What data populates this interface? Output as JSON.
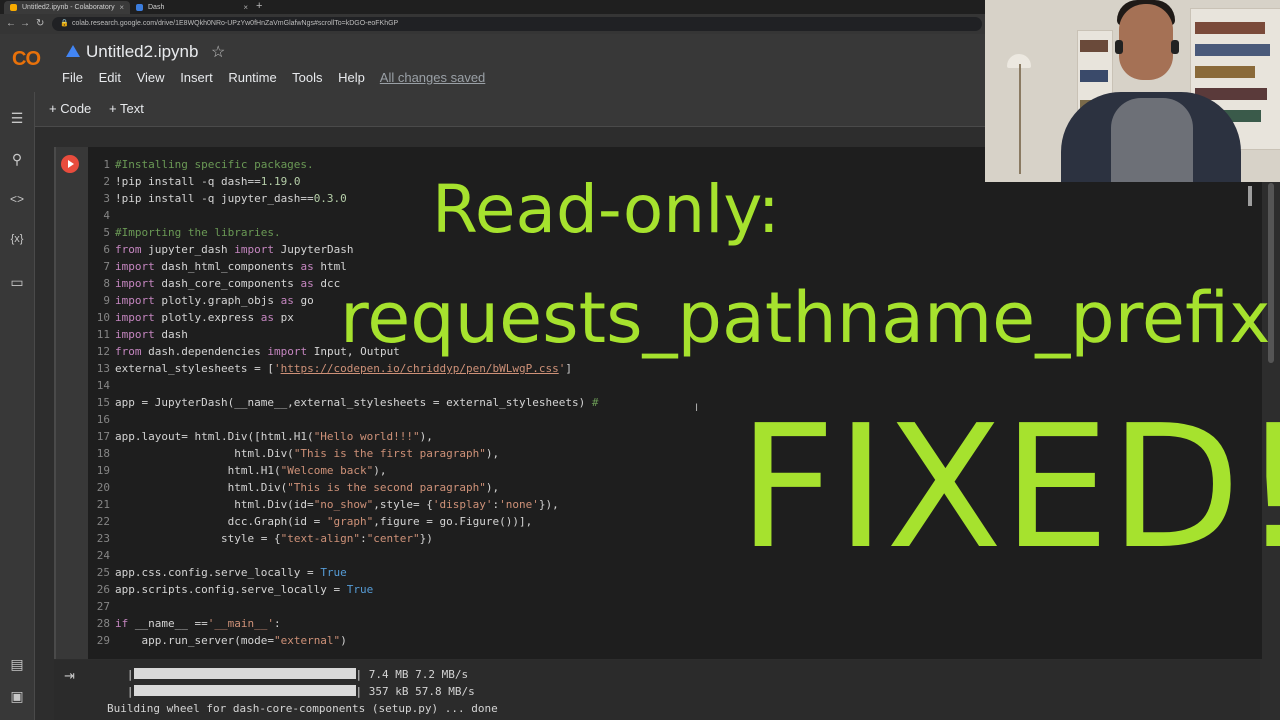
{
  "browser": {
    "tabs": [
      {
        "title": "Untitled2.ipynb - Colaboratory"
      },
      {
        "title": "Dash"
      }
    ],
    "url": "colab.research.google.com/drive/1E8WQkh0NRo-UPzYw0fHnZaVmGlafwNgs#scrollTo=kDGO-eoFKhGP"
  },
  "colab": {
    "logo": "CO",
    "title": "Untitled2.ipynb",
    "menu": [
      "File",
      "Edit",
      "View",
      "Insert",
      "Runtime",
      "Tools",
      "Help"
    ],
    "saved_status": "All changes saved",
    "toolbar": {
      "add_code": "+ Code",
      "add_text": "+ Text"
    }
  },
  "code_lines": [
    {
      "n": "1",
      "parts": [
        [
          "c-com",
          "#Installing specific packages."
        ]
      ]
    },
    {
      "n": "2",
      "parts": [
        [
          "c-plain",
          "!pip install -q dash=="
        ],
        [
          "c-num",
          "1.19.0"
        ]
      ]
    },
    {
      "n": "3",
      "parts": [
        [
          "c-plain",
          "!pip install -q jupyter_dash=="
        ],
        [
          "c-num",
          "0.3.0"
        ]
      ]
    },
    {
      "n": "4",
      "parts": []
    },
    {
      "n": "5",
      "parts": [
        [
          "c-com",
          "#Importing the libraries."
        ]
      ]
    },
    {
      "n": "6",
      "parts": [
        [
          "c-kw",
          "from"
        ],
        [
          "c-plain",
          " jupyter_dash "
        ],
        [
          "c-kw",
          "import"
        ],
        [
          "c-plain",
          " JupyterDash"
        ]
      ]
    },
    {
      "n": "7",
      "parts": [
        [
          "c-kw",
          "import"
        ],
        [
          "c-plain",
          " dash_html_components "
        ],
        [
          "c-kw",
          "as"
        ],
        [
          "c-plain",
          " html"
        ]
      ]
    },
    {
      "n": "8",
      "parts": [
        [
          "c-kw",
          "import"
        ],
        [
          "c-plain",
          " dash_core_components "
        ],
        [
          "c-kw",
          "as"
        ],
        [
          "c-plain",
          " dcc"
        ]
      ]
    },
    {
      "n": "9",
      "parts": [
        [
          "c-kw",
          "import"
        ],
        [
          "c-plain",
          " plotly.graph_objs "
        ],
        [
          "c-kw",
          "as"
        ],
        [
          "c-plain",
          " go"
        ]
      ]
    },
    {
      "n": "10",
      "parts": [
        [
          "c-kw",
          "import"
        ],
        [
          "c-plain",
          " plotly.express "
        ],
        [
          "c-kw",
          "as"
        ],
        [
          "c-plain",
          " px"
        ]
      ]
    },
    {
      "n": "11",
      "parts": [
        [
          "c-kw",
          "import"
        ],
        [
          "c-plain",
          " dash"
        ]
      ]
    },
    {
      "n": "12",
      "parts": [
        [
          "c-kw",
          "from"
        ],
        [
          "c-plain",
          " dash.dependencies "
        ],
        [
          "c-kw",
          "import"
        ],
        [
          "c-plain",
          " Input, Output"
        ]
      ]
    },
    {
      "n": "13",
      "parts": [
        [
          "c-plain",
          "external_stylesheets = ["
        ],
        [
          "c-str",
          "'"
        ],
        [
          "c-url",
          "https://codepen.io/chriddyp/pen/bWLwgP.css"
        ],
        [
          "c-str",
          "'"
        ],
        [
          "c-plain",
          "]"
        ]
      ]
    },
    {
      "n": "14",
      "parts": []
    },
    {
      "n": "15",
      "parts": [
        [
          "c-plain",
          "app = JupyterDash(__name__,external_stylesheets = external_stylesheets) "
        ],
        [
          "c-com",
          "#"
        ]
      ]
    },
    {
      "n": "16",
      "parts": []
    },
    {
      "n": "17",
      "parts": [
        [
          "c-plain",
          "app.layout= html.Div([html.H1("
        ],
        [
          "c-str",
          "\"Hello world!!!\""
        ],
        [
          "c-plain",
          "),"
        ]
      ]
    },
    {
      "n": "18",
      "parts": [
        [
          "c-plain",
          "                  html.Div("
        ],
        [
          "c-str",
          "\"This is the first paragraph\""
        ],
        [
          "c-plain",
          "),"
        ]
      ]
    },
    {
      "n": "19",
      "parts": [
        [
          "c-plain",
          "                 html.H1("
        ],
        [
          "c-str",
          "\"Welcome back\""
        ],
        [
          "c-plain",
          "),"
        ]
      ]
    },
    {
      "n": "20",
      "parts": [
        [
          "c-plain",
          "                 html.Div("
        ],
        [
          "c-str",
          "\"This is the second paragraph\""
        ],
        [
          "c-plain",
          "),"
        ]
      ]
    },
    {
      "n": "21",
      "parts": [
        [
          "c-plain",
          "                  html.Div(id="
        ],
        [
          "c-str",
          "\"no_show\""
        ],
        [
          "c-plain",
          ",style= {"
        ],
        [
          "c-str",
          "'display'"
        ],
        [
          "c-plain",
          ":"
        ],
        [
          "c-str",
          "'none'"
        ],
        [
          "c-plain",
          "}),"
        ]
      ]
    },
    {
      "n": "22",
      "parts": [
        [
          "c-plain",
          "                 dcc.Graph(id = "
        ],
        [
          "c-str",
          "\"graph\""
        ],
        [
          "c-plain",
          ",figure = go.Figure())],"
        ]
      ]
    },
    {
      "n": "23",
      "parts": [
        [
          "c-plain",
          "                style = {"
        ],
        [
          "c-str",
          "\"text-align\""
        ],
        [
          "c-plain",
          ":"
        ],
        [
          "c-str",
          "\"center\""
        ],
        [
          "c-plain",
          "})"
        ]
      ]
    },
    {
      "n": "24",
      "parts": []
    },
    {
      "n": "25",
      "parts": [
        [
          "c-plain",
          "app.css.config.serve_locally = "
        ],
        [
          "c-bool",
          "True"
        ]
      ]
    },
    {
      "n": "26",
      "parts": [
        [
          "c-plain",
          "app.scripts.config.serve_locally = "
        ],
        [
          "c-bool",
          "True"
        ]
      ]
    },
    {
      "n": "27",
      "parts": []
    },
    {
      "n": "28",
      "parts": [
        [
          "c-kw",
          "if"
        ],
        [
          "c-plain",
          " __name__ =="
        ],
        [
          "c-str",
          "'__main__'"
        ],
        [
          "c-plain",
          ":"
        ]
      ]
    },
    {
      "n": "29",
      "parts": [
        [
          "c-plain",
          "    app.run_server(mode="
        ],
        [
          "c-str",
          "\"external\""
        ],
        [
          "c-plain",
          ")"
        ]
      ]
    }
  ],
  "output": {
    "lines": [
      {
        "progress": 1.0,
        "text": "| 7.4 MB 7.2 MB/s"
      },
      {
        "progress": 1.0,
        "text": "| 357 kB 57.8 MB/s"
      },
      {
        "progress": null,
        "text": "Building wheel for dash-core-components (setup.py) ... done"
      }
    ]
  },
  "overlay": {
    "line1": "Read-only:",
    "line2": "requests_pathname_prefix",
    "line3": "FIXED!",
    "color": "#a6e22e"
  }
}
